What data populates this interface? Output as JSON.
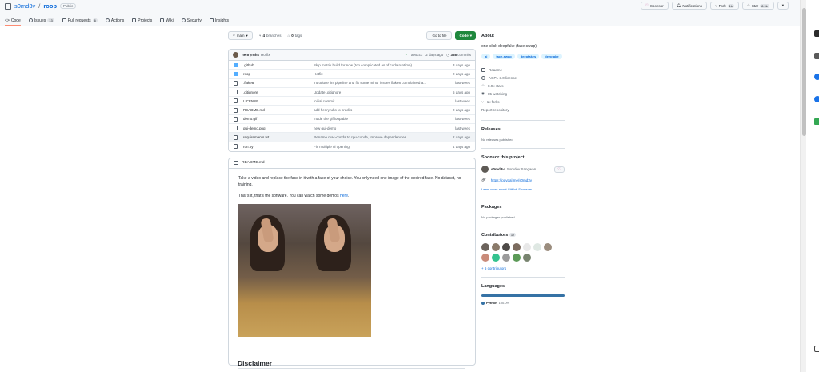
{
  "repo": {
    "owner": "s0md3v",
    "separator": "/",
    "name": "roop",
    "visibility": "Public"
  },
  "header_actions": {
    "sponsor": "Sponsor",
    "notifications": "Notifications",
    "fork": "Fork",
    "fork_count": "1k",
    "star": "Star",
    "star_count": "8.9k"
  },
  "tabs": [
    {
      "label": "Code"
    },
    {
      "label": "Issues",
      "count": "13"
    },
    {
      "label": "Pull requests",
      "count": "6"
    },
    {
      "label": "Actions"
    },
    {
      "label": "Projects"
    },
    {
      "label": "Wiki"
    },
    {
      "label": "Security"
    },
    {
      "label": "Insights"
    }
  ],
  "toolbar": {
    "branch": "main",
    "branches_count": "4",
    "branches_label": "branches",
    "tags_count": "0",
    "tags_label": "tags",
    "go_to_file": "Go to file",
    "code": "Code"
  },
  "last_commit": {
    "author": "henryruhs",
    "message": "Hotfix",
    "hash": "ae5ccc",
    "when": "2 days ago",
    "commits_count": "358",
    "commits_label": "commits"
  },
  "files": [
    {
      "type": "dir",
      "name": ".github",
      "message": "Skip matrix build for now (too complicated as of cuda runtime)",
      "date": "3 days ago"
    },
    {
      "type": "dir",
      "name": "roop",
      "message": "Hotfix",
      "date": "2 days ago"
    },
    {
      "type": "file",
      "name": ".flake8",
      "message": "Introduce lint pipeline and fix some minor issues flake8 complained a...",
      "date": "last week"
    },
    {
      "type": "file",
      "name": ".gitignore",
      "message": "Update .gitignore",
      "date": "5 days ago"
    },
    {
      "type": "file",
      "name": "LICENSE",
      "message": "Initial commit",
      "date": "last week"
    },
    {
      "type": "file",
      "name": "README.md",
      "message": "add henryruhs to credits",
      "date": "2 days ago"
    },
    {
      "type": "file",
      "name": "demo.gif",
      "message": "made the gif loopable",
      "date": "last week"
    },
    {
      "type": "file",
      "name": "gui-demo.png",
      "message": "new gui-demo",
      "date": "last week"
    },
    {
      "type": "file",
      "name": "requirements.txt",
      "message": "Rename mac-conda to cpu-conda, Improve dependencies",
      "date": "2 days ago"
    },
    {
      "type": "file",
      "name": "run.py",
      "message": "Fix multiple ui opening",
      "date": "4 days ago"
    }
  ],
  "readme": {
    "filename": "README.md",
    "para1": "Take a video and replace the face in it with a face of your choice. You only need one image of the desired face. No dataset, no training.",
    "para2_prefix": "That's it, that's the software. You can watch some demos ",
    "para2_link": "here",
    "para2_suffix": ".",
    "disclaimer": "Disclaimer"
  },
  "about": {
    "heading": "About",
    "description": "one-click deepfake (face swap)",
    "topics": [
      "ai",
      "face-swap",
      "deepfakes",
      "deepfake"
    ],
    "readme": "Readme",
    "license": "AGPL-3.0 license",
    "stars": "8.9k stars",
    "watching": "85 watching",
    "forks": "1k forks",
    "report": "Report repository"
  },
  "releases": {
    "heading": "Releases",
    "empty": "No releases published"
  },
  "sponsor": {
    "heading": "Sponsor this project",
    "user": "s0md3v",
    "full_name": "Somdev Sangwan",
    "link": "https://paypal.me/s0md3v",
    "learn": "Learn more about GitHub Sponsors"
  },
  "packages": {
    "heading": "Packages",
    "empty": "No packages published"
  },
  "contributors": {
    "heading": "Contributors",
    "count": "17",
    "more": "+ 6 contributors",
    "avatar_colors": [
      "#6b625b",
      "#8a7a6a",
      "#4d4a47",
      "#7b6b5e",
      "#e8e8e8",
      "#dfe8e3",
      "#9b8d7e",
      "#c98b7a",
      "#34c38f",
      "#9b9b9b",
      "#5c9a57",
      "#78846f"
    ]
  },
  "languages": {
    "heading": "Languages",
    "name": "Python",
    "percent": "100.0%",
    "color": "#3572a5"
  }
}
